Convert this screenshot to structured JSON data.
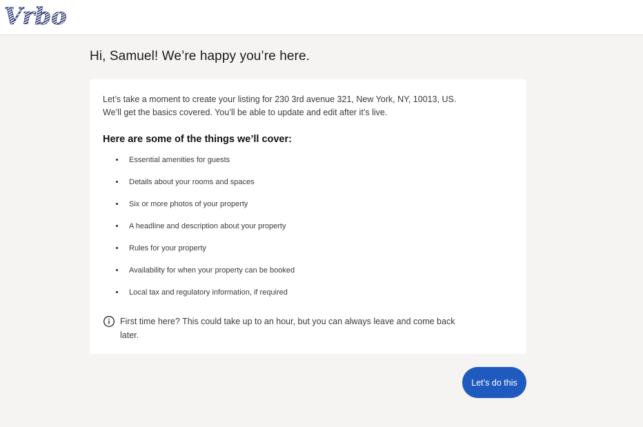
{
  "header": {
    "logo_text": "Vrbo",
    "logo_color": "#1c2a6b"
  },
  "greeting": "Hi, Samuel! We’re happy you’re here.",
  "intro": {
    "line1": "Let’s take a moment to create your listing for 230 3rd avenue 321, New York, NY, 10013, US.",
    "line2": "We’ll get the basics covered. You’ll be able to update and edit after it’s live."
  },
  "cover_heading": "Here are some of the things we’ll cover:",
  "cover_items": [
    "Essential amenities for guests",
    "Details about your rooms and spaces",
    "Six or more photos of your property",
    "A headline and description about your property",
    "Rules for your property",
    "Availability for when your property can be booked",
    "Local tax and regulatory information, if required"
  ],
  "notice": {
    "icon": "info-icon",
    "line1": "First time here? This could take up to an hour, but you can always leave and come back",
    "line2": "later."
  },
  "cta": {
    "label": "Let’s do this",
    "color": "#1f5bbf"
  }
}
